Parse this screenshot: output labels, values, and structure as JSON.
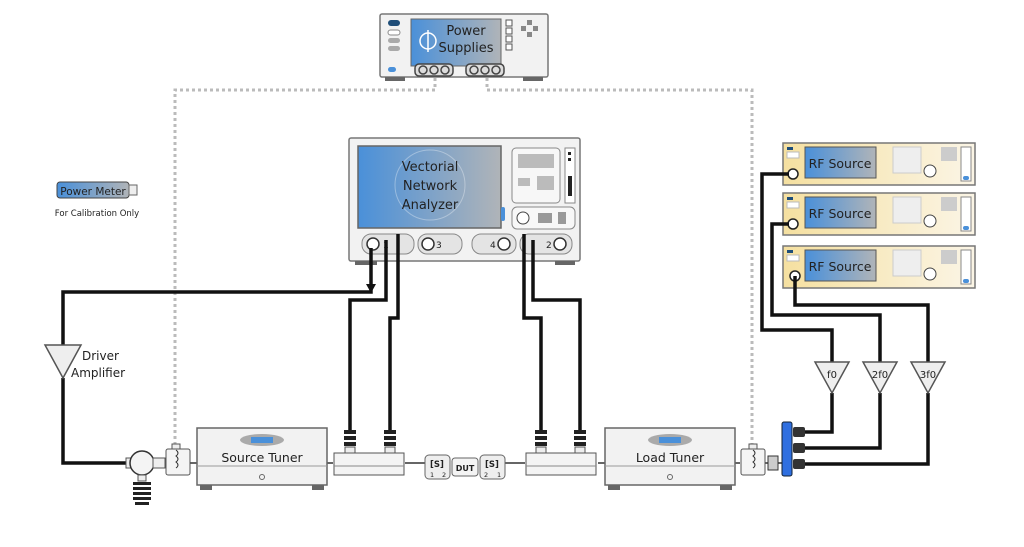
{
  "power_supplies": {
    "line1": "Power",
    "line2": "Supplies"
  },
  "vna": {
    "line1": "Vectorial",
    "line2": "Network",
    "line3": "Analyzer",
    "ports": [
      "1",
      "3",
      "4",
      "2"
    ]
  },
  "power_meter": {
    "label": "Power Meter",
    "note": "For Calibration Only"
  },
  "rf_sources": [
    {
      "label": "RF Source"
    },
    {
      "label": "RF Source"
    },
    {
      "label": "RF Source"
    }
  ],
  "driver_amplifier": {
    "line1": "Driver",
    "line2": "Amplifier"
  },
  "source_tuner": {
    "label": "Source Tuner"
  },
  "load_tuner": {
    "label": "Load Tuner"
  },
  "dut": {
    "label": "DUT",
    "s_left": "[S]",
    "s_left_ports": [
      "1",
      "2"
    ],
    "s_right": "[S]",
    "s_right_ports": [
      "2",
      "1"
    ]
  },
  "harmonic_amps": [
    {
      "label": "f0"
    },
    {
      "label": "2f0"
    },
    {
      "label": "3f0"
    }
  ],
  "colors": {
    "screen": "#4a90d9",
    "rf_source_body": "#f5e6b8",
    "combiner": "#2f6fe0",
    "cable": "#111111",
    "dc_line": "#bbbbbb"
  }
}
